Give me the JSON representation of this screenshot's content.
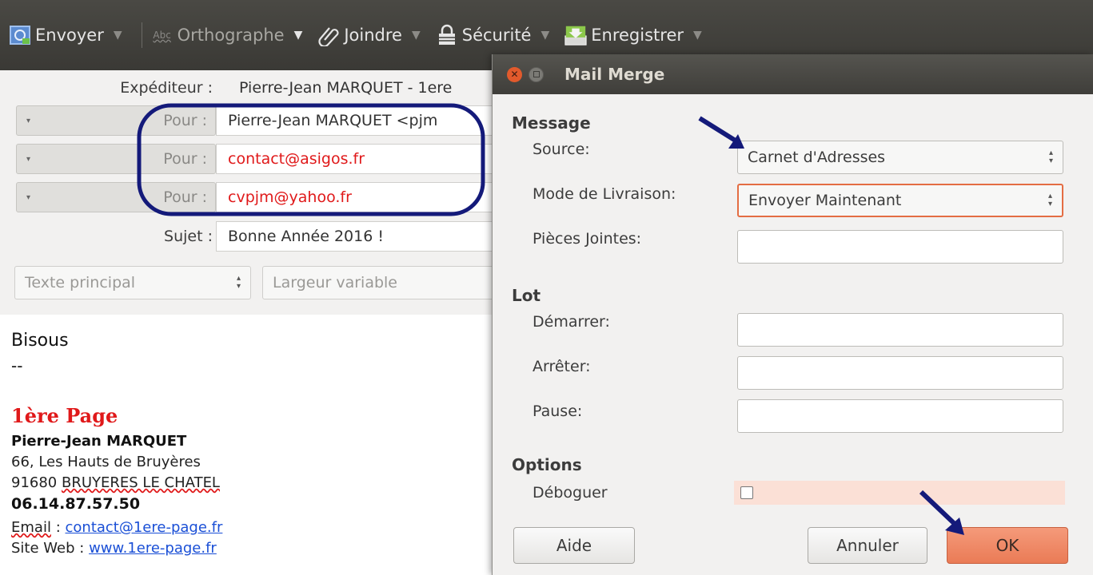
{
  "toolbar": {
    "send_label": "Envoyer",
    "spelling_label": "Orthographe",
    "spelling_glyph": "Abc",
    "attach_label": "Joindre",
    "security_label": "Sécurité",
    "save_label": "Enregistrer"
  },
  "compose": {
    "from": {
      "label": "Expéditeur :",
      "value": "Pierre-Jean MARQUET - 1ere"
    },
    "recipients": [
      {
        "type": "Pour :",
        "address": "Pierre-Jean MARQUET <pjm"
      },
      {
        "type": "Pour :",
        "address": "contact@asigos.fr"
      },
      {
        "type": "Pour :",
        "address": "cvpjm@yahoo.fr"
      }
    ],
    "subject": {
      "label": "Sujet :",
      "value": "Bonne Année 2016 !"
    },
    "format": {
      "paragraph": "Texte principal",
      "width": "Largeur variable"
    }
  },
  "body": {
    "greeting": "Bisous",
    "separator": "--",
    "sig_brand": "1ère Page",
    "sig_name": "Pierre-Jean MARQUET",
    "sig_address1": "66, Les Hauts de Bruyères",
    "sig_postcode": "91680",
    "sig_city": "BRUYERES LE CHATEL",
    "sig_phone": "06.14.87.57.50",
    "sig_email_label": "Email",
    "sig_email": "contact@1ere-page.fr",
    "sig_web_label": "Site Web",
    "sig_web": "www.1ere-page.fr",
    "sig_colon": ":"
  },
  "dialog": {
    "title": "Mail Merge",
    "message_section": "Message",
    "source_label": "Source:",
    "source_value": "Carnet d'Adresses",
    "delivery_label": "Mode de Livraison:",
    "delivery_value": "Envoyer Maintenant",
    "attachments_label": "Pièces Jointes:",
    "attachments_value": "",
    "batch_section": "Lot",
    "start_label": "Démarrer:",
    "start_value": "",
    "stop_label": "Arrêter:",
    "stop_value": "",
    "pause_label": "Pause:",
    "pause_value": "",
    "options_section": "Options",
    "debug_label": "Déboguer",
    "debug_checked": false,
    "help_button": "Aide",
    "cancel_button": "Annuler",
    "ok_button": "OK"
  },
  "colors": {
    "toolbar_bg": "#3f3e3a",
    "accent_orange": "#ea7b56",
    "recipient_red": "#e0191a",
    "annotation_navy": "#141a7a",
    "link_blue": "#1a4fd6"
  }
}
